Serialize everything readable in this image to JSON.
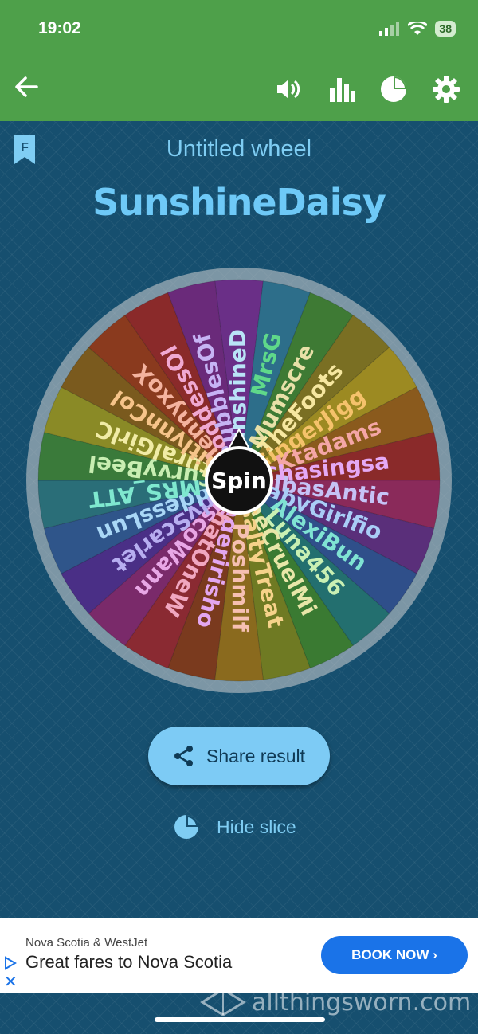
{
  "status_bar": {
    "time": "19:02",
    "battery": "38"
  },
  "header": {
    "icons": [
      "back-arrow-icon",
      "volume-icon",
      "stats-icon",
      "pie-icon",
      "gear-icon"
    ]
  },
  "wheel": {
    "title": "Untitled wheel",
    "winner": "SunshineDaisy",
    "spin_label": "Spin",
    "entries": [
      "SunshineD",
      "MrsG",
      "Mumscre",
      "TheFoots",
      "GingerJigg",
      "Ktadams",
      "Chasingsa",
      "AlbasAntic",
      "BabyGirlfio",
      "AlexiBun",
      "Luna456",
      "TheCruelMi",
      "SaltyTreat",
      "Poshmilf",
      "Gingeririsho",
      "ThatOneW",
      "WiscoWann",
      "LadyScarlet",
      "GoddessLun",
      "MRS_ATT",
      "CurvyBeel",
      "NaturalGirlC",
      "KaitlynnCol",
      "JennyxoX",
      "GoddessOl",
      "BubblesOf"
    ],
    "colors": [
      "#6a2f87",
      "#2d6e8a",
      "#3e7a34",
      "#7a6f23",
      "#9c8a22",
      "#8a5a1d",
      "#8a2a2a",
      "#8a2a5a",
      "#5a2f7a",
      "#2f4f8a",
      "#236f6f",
      "#3a7a32",
      "#6f7a23",
      "#8a6a1e",
      "#7a3a1e",
      "#8a2a32",
      "#7a2a6a",
      "#4a2f86",
      "#2f558a",
      "#2a6e78",
      "#3a7a3a",
      "#8a8a26",
      "#7a5a1e",
      "#8a3a1e",
      "#8a2a2a",
      "#6a2a7a"
    ],
    "text_colors": [
      "#b9e3f6",
      "#5fd98a",
      "#e8e0a8",
      "#f6e7a0",
      "#f5c26b",
      "#f4a6a6",
      "#e5a9f5",
      "#c6c3f6",
      "#a9cdf6",
      "#7fe3d3",
      "#c9f0b3",
      "#e8e6a8",
      "#f6d28a",
      "#f6c0b2",
      "#e3a6f0",
      "#f0a7c0",
      "#e8a7e6",
      "#b7aef0",
      "#a9d7f6",
      "#7fe8cf",
      "#c9eeb2",
      "#f1eca6",
      "#f6c48a",
      "#f4b39f",
      "#f0a9d2",
      "#c6b3f4"
    ]
  },
  "actions": {
    "share_label": "Share result",
    "hide_label": "Hide slice"
  },
  "ad": {
    "advertiser": "Nova Scotia & WestJet",
    "headline": "Great fares to Nova Scotia",
    "button": "BOOK NOW ›",
    "close": "✕"
  },
  "watermark": "allthingsworn.com"
}
